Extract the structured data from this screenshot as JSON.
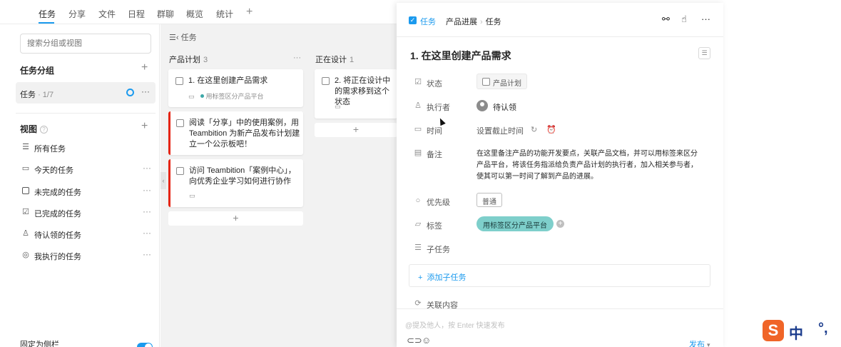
{
  "colors": {
    "accent": "#1b9aee",
    "danger": "#e62412",
    "tag": "#7ecfcb",
    "ime": "#f06528"
  },
  "topnav": {
    "tabs": [
      "任务",
      "分享",
      "文件",
      "日程",
      "群聊",
      "概览",
      "统计"
    ],
    "active_tab": "任务",
    "add_icon": "plus-icon"
  },
  "sidebar": {
    "search_placeholder": "搜索分组或视图",
    "groups_title": "任务分组",
    "group_item": {
      "label": "任务",
      "count": "· 1/7"
    },
    "views_title": "视图",
    "views": [
      {
        "label": "所有任务",
        "icon": "list-icon"
      },
      {
        "label": "今天的任务",
        "icon": "calendar-icon"
      },
      {
        "label": "未完成的任务",
        "icon": "checkbox-empty-icon"
      },
      {
        "label": "已完成的任务",
        "icon": "checkbox-checked-icon"
      },
      {
        "label": "待认领的任务",
        "icon": "user-icon"
      },
      {
        "label": "我执行的任务",
        "icon": "user-circle-icon"
      }
    ],
    "pin_label": "固定为侧栏"
  },
  "board": {
    "breadcrumb": "任务",
    "columns": [
      {
        "title": "产品计划",
        "count": "3",
        "cards": [
          {
            "text": "1. 在这里创建产品需求",
            "meta_tag": "用标签区分产品平台"
          },
          {
            "text": "阅读「分享」中的使用案例，用 Teambition 为新产品发布计划建立一个公示板吧！"
          },
          {
            "text": "访问 Teambition「案例中心」，向优秀企业学习如何进行协作"
          }
        ]
      },
      {
        "title": "正在设计",
        "count": "1",
        "cards": [
          {
            "text": "2. 将正在设计中的需求移到这个状态"
          }
        ]
      }
    ],
    "add_label": "+"
  },
  "panel": {
    "type_label": "任务",
    "path_project": "产品进展",
    "path_sep": "›",
    "path_item": "任务",
    "title": "1. 在这里创建产品需求",
    "fields": {
      "status_label": "状态",
      "status_value": "产品计划",
      "assignee_label": "执行者",
      "assignee_value": "待认领",
      "time_label": "时间",
      "time_value": "设置截止时间",
      "note_label": "备注",
      "note_value": "在这里备注产品的功能开发要点，关联产品文档，并可以用标签来区分产品平台，将该任务指派给负责产品计划的执行者，加入相关参与者，使其可以第一时间了解到产品的进展。",
      "priority_label": "优先级",
      "priority_value": "普通",
      "tag_label": "标签",
      "tag_value": "用标签区分产品平台",
      "subtask_label": "子任务",
      "add_subtask": "添加子任务",
      "related_label": "关联内容"
    },
    "comment_placeholder": "@提及他人，按 Enter 快速发布",
    "send_label": "发布"
  },
  "ime": {
    "zh": "中",
    "punct": "°,"
  }
}
